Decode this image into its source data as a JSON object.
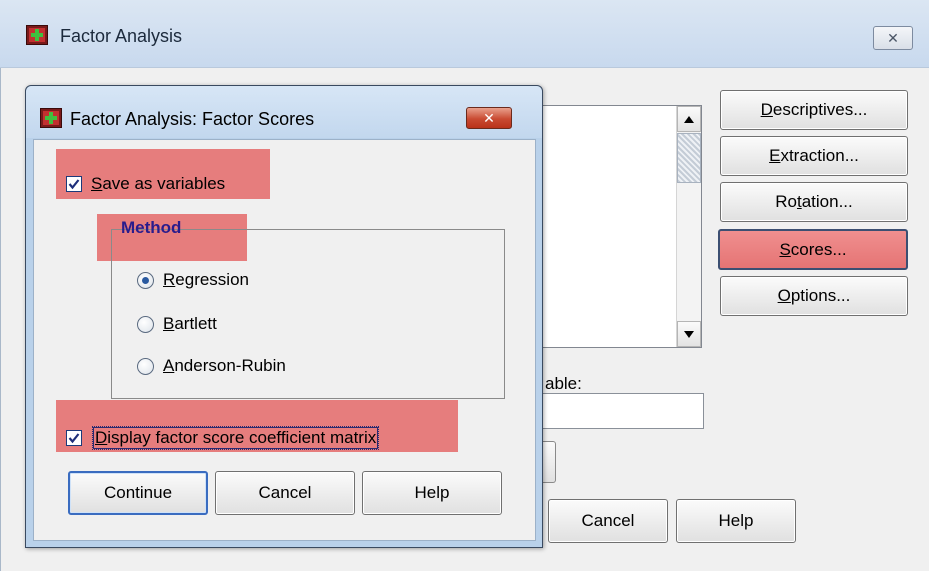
{
  "parent": {
    "title": "Factor Analysis",
    "close_label": "✕",
    "buttons": {
      "descriptives_key": "D",
      "descriptives_rest": "escriptives...",
      "extraction_key": "E",
      "extraction_rest": "xtraction...",
      "rotation_pre": "Ro",
      "rotation_key": "t",
      "rotation_rest": "ation...",
      "scores_key": "S",
      "scores_rest": "cores...",
      "options_key": "O",
      "options_rest": "ptions..."
    },
    "variable_label": "able:",
    "cancel_label": "Cancel",
    "help_label": "Help"
  },
  "child": {
    "title": "Factor Analysis: Factor Scores",
    "close_label": "✕",
    "save": {
      "key": "S",
      "rest": "ave as variables",
      "checked": true
    },
    "method": {
      "title": "Method",
      "options": [
        {
          "key": "R",
          "rest": "egression",
          "selected": true
        },
        {
          "key": "B",
          "rest": "artlett",
          "selected": false
        },
        {
          "key": "A",
          "rest": "nderson-Rubin",
          "selected": false
        }
      ]
    },
    "display": {
      "key": "D",
      "rest": "isplay factor score coefficient matrix",
      "checked": true
    },
    "buttons": {
      "continue": "Continue",
      "cancel": "Cancel",
      "help": "Help"
    }
  },
  "icons": {
    "app_icon": "factor-analysis-icon",
    "close": "close-icon",
    "check": "checkmark-icon",
    "scroll_up": "arrow-up-icon",
    "scroll_down": "arrow-down-icon"
  },
  "colors": {
    "highlight": "#e47070",
    "method_title": "#2a1c8c",
    "child_close": "#c94a32"
  }
}
